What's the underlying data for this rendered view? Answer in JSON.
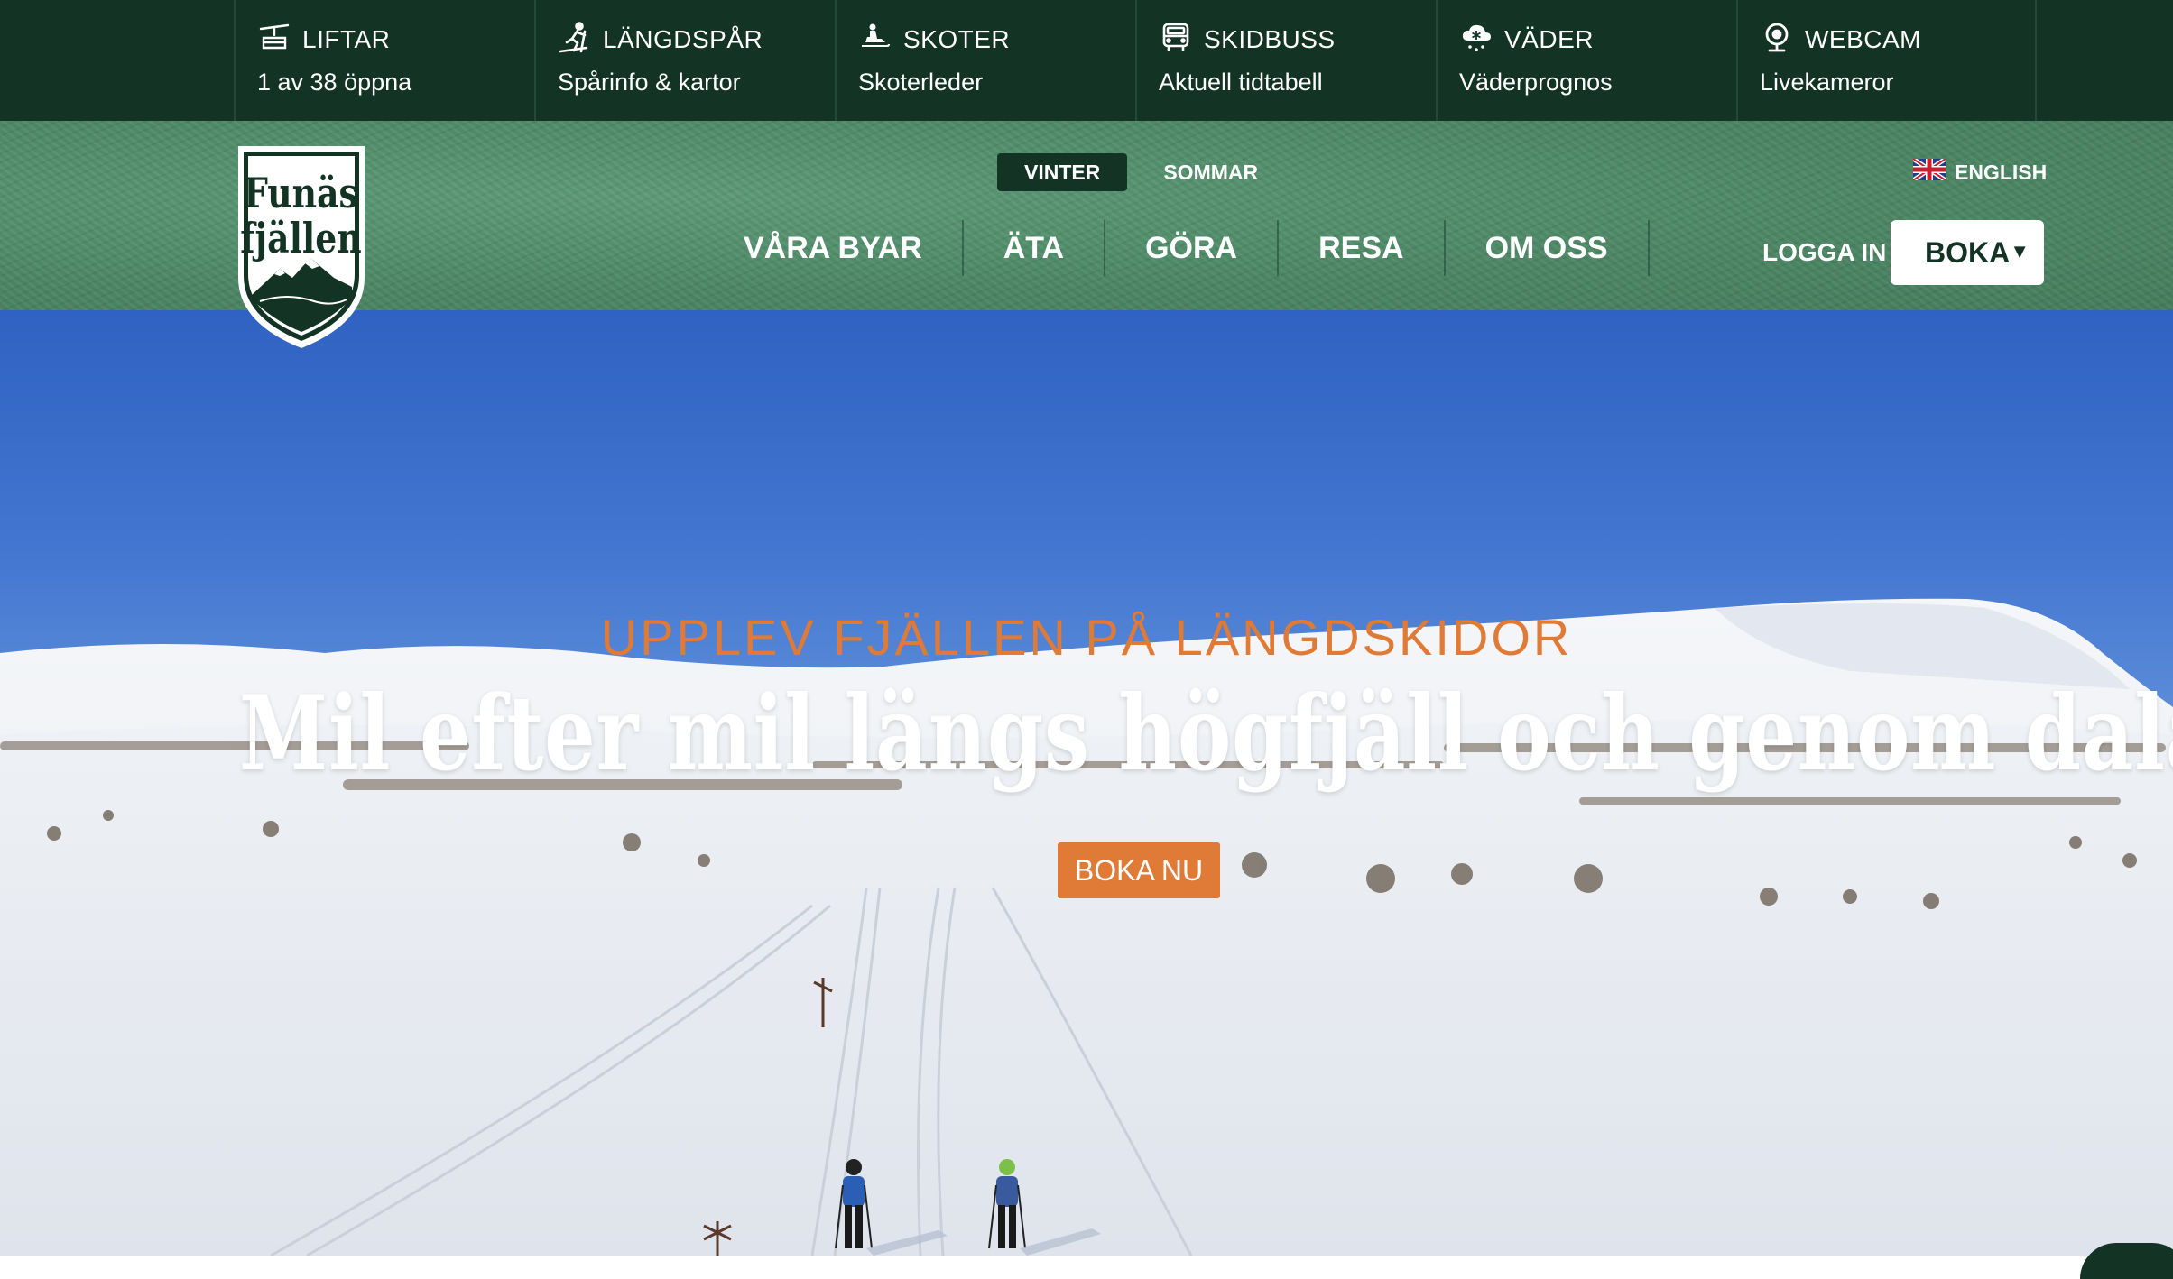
{
  "topbar": {
    "items": [
      {
        "icon": "ski-lift-icon",
        "title": "LIFTAR",
        "sub": "1 av 38 öppna"
      },
      {
        "icon": "cross-country-skier-icon",
        "title": "LÄNGDSPÅR",
        "sub": "Spårinfo & kartor"
      },
      {
        "icon": "snowmobile-icon",
        "title": "SKOTER",
        "sub": "Skoterleder"
      },
      {
        "icon": "bus-icon",
        "title": "SKIDBUSS",
        "sub": "Aktuell tidtabell"
      },
      {
        "icon": "weather-cloud-snow-icon",
        "title": "VÄDER",
        "sub": "Väderprognos"
      },
      {
        "icon": "webcam-icon",
        "title": "WEBCAM",
        "sub": "Livekameror"
      }
    ]
  },
  "header": {
    "logo": {
      "line1": "Funäs",
      "line2": "fjällen"
    },
    "season": {
      "winter": "VINTER",
      "summer": "SOMMAR",
      "active": "VINTER"
    },
    "language": {
      "label": "ENGLISH",
      "icon": "uk-flag-icon"
    },
    "nav": [
      "VÅRA BYAR",
      "ÄTA",
      "GÖRA",
      "RESA",
      "OM OSS"
    ],
    "login": "LOGGA IN",
    "book": "BOKA"
  },
  "hero": {
    "kicker": "UPPLEV FJÄLLEN PÅ LÄNGDSKIDOR",
    "title": "Mil efter mil längs högfjäll och genom dalar",
    "cta": "BOKA NU"
  },
  "colors": {
    "topbar": "#133324",
    "header": "#4a8663",
    "accent": "#e07a37",
    "sky": "#3a6bc8"
  }
}
